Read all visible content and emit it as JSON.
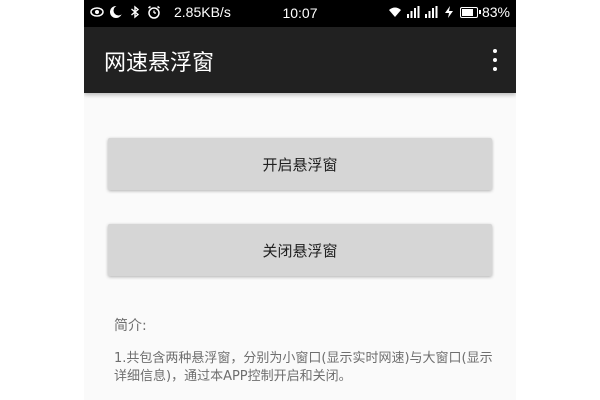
{
  "status_bar": {
    "net_speed": "2.85KB/s",
    "time": "10:07",
    "battery_percent": "83%",
    "icons_left": [
      "eye-icon",
      "moon-icon",
      "bluetooth-icon",
      "alarm-icon"
    ],
    "icons_right": [
      "wifi-icon",
      "signal-icon",
      "signal-icon",
      "charging-icon",
      "battery-icon"
    ]
  },
  "app_bar": {
    "title": "网速悬浮窗",
    "menu_icon": "more-vert-icon"
  },
  "buttons": {
    "open_label": "开启悬浮窗",
    "close_label": "关闭悬浮窗"
  },
  "intro": {
    "label": "简介:",
    "text": "1.共包含两种悬浮窗，分别为小窗口(显示实时网速)与大窗口(显示详细信息)，通过本APP控制开启和关闭。"
  },
  "colors": {
    "status_bar_bg": "#000000",
    "app_bar_bg": "#212121",
    "content_bg": "#fafafa",
    "button_bg": "#d6d6d6",
    "intro_text": "#6e6e6e"
  }
}
